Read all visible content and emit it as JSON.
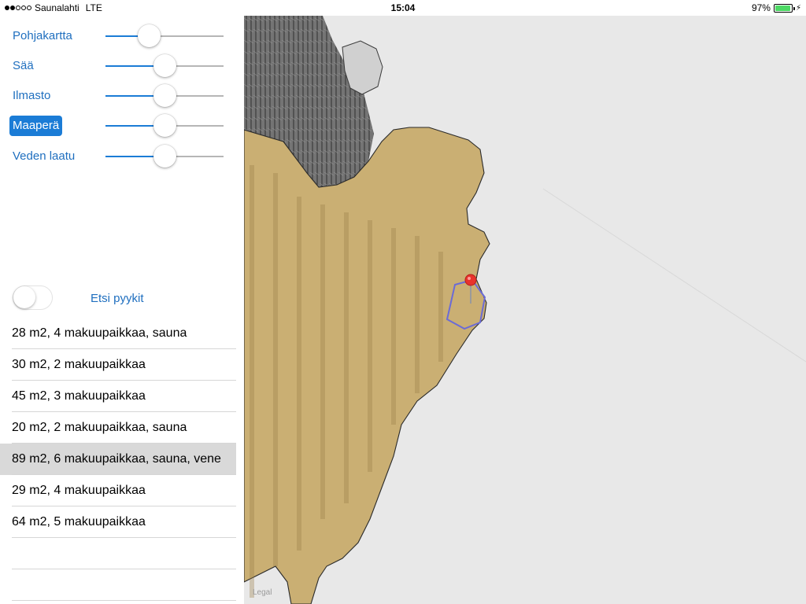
{
  "status_bar": {
    "carrier": "Saunalahti",
    "network": "LTE",
    "time": "15:04",
    "battery": "97%",
    "battery_level": 0.97
  },
  "layers": [
    {
      "label": "Pohjakartta",
      "value": 0.37,
      "active": false
    },
    {
      "label": "Sää",
      "value": 0.5,
      "active": false
    },
    {
      "label": "Ilmasto",
      "value": 0.5,
      "active": false
    },
    {
      "label": "Maaperä",
      "value": 0.5,
      "active": true
    },
    {
      "label": "Veden laatu",
      "value": 0.5,
      "active": false
    }
  ],
  "search_toggle": {
    "label": "Etsi pyykit",
    "on": false
  },
  "cabins": [
    "28 m2, 4 makuupaikkaa, sauna",
    "30 m2, 2 makuupaikkaa",
    "45 m2, 3 makuupaikkaa",
    "20 m2, 2 makuupaikkaa, sauna",
    "89 m2, 6 makuupaikkaa, sauna, vene",
    "29 m2, 4 makuupaikkaa",
    "64 m2, 5 makuupaikkaa",
    "",
    ""
  ],
  "selected_cabin_index": 4,
  "map": {
    "legal": "Legal",
    "soil_color": "#c8a55e",
    "pin_color": "#e8332d",
    "selection_color": "#6b6bd6"
  },
  "colors": {
    "accent": "#1b7cd6",
    "battery": "#4cd964"
  }
}
